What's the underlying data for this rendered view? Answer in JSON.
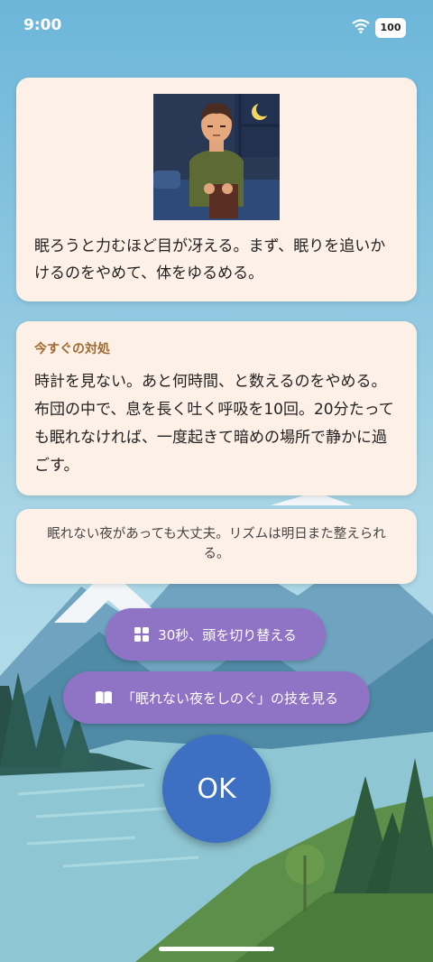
{
  "status_bar": {
    "time": "9:00",
    "battery": "100"
  },
  "card_top": {
    "message": "眠ろうと力むほど目が冴える。まず、眠りを追いかけるのをやめて、体をゆるめる。"
  },
  "card_action": {
    "heading": "今すぐの対処",
    "body": "時計を見ない。あと何時間、と数えるのをやめる。布団の中で、息を長く吐く呼吸を10回。20分たっても眠れなければ、一度起きて暗めの場所で静かに過ごす。"
  },
  "card_reassure": {
    "message": "眠れない夜があっても大丈夫。リズムは明日また整えられる。"
  },
  "buttons": {
    "switch_label": "30秒、頭を切り替える",
    "switch_icon": "grid-icon",
    "tips_label": "「眠れない夜をしのぐ」の技を見る",
    "tips_icon": "book-icon",
    "ok_label": "OK"
  },
  "colors": {
    "card_bg": "#fdf0e6",
    "pill_bg": "#8f73c5",
    "ok_bg": "#3d6fc2",
    "heading_accent": "#a06a30"
  }
}
